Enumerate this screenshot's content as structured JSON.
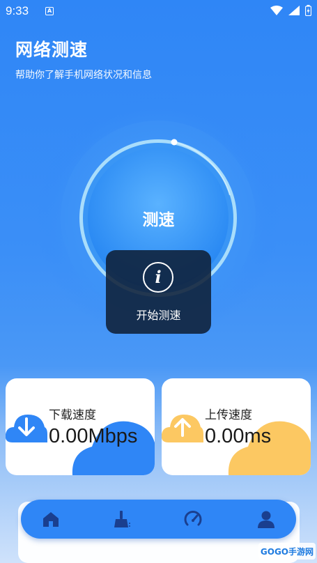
{
  "status_bar": {
    "time": "9:33",
    "notif_glyph": "A"
  },
  "header": {
    "title": "网络测速",
    "subtitle": "帮助你了解手机网络状况和信息"
  },
  "dial": {
    "label": "测速"
  },
  "toast": {
    "label": "开始测速"
  },
  "download": {
    "label": "下载速度",
    "value": "0.00Mbps"
  },
  "upload": {
    "label": "上传速度",
    "value": "0.00ms"
  },
  "nav": {
    "items": [
      "home-icon",
      "clean-icon",
      "speed-icon",
      "profile-icon"
    ]
  },
  "watermark": {
    "text": "GOGO手游网"
  },
  "colors": {
    "primary": "#2f86f6",
    "upload_accent": "#f9c25a",
    "toast_bg": "#0f2038"
  }
}
